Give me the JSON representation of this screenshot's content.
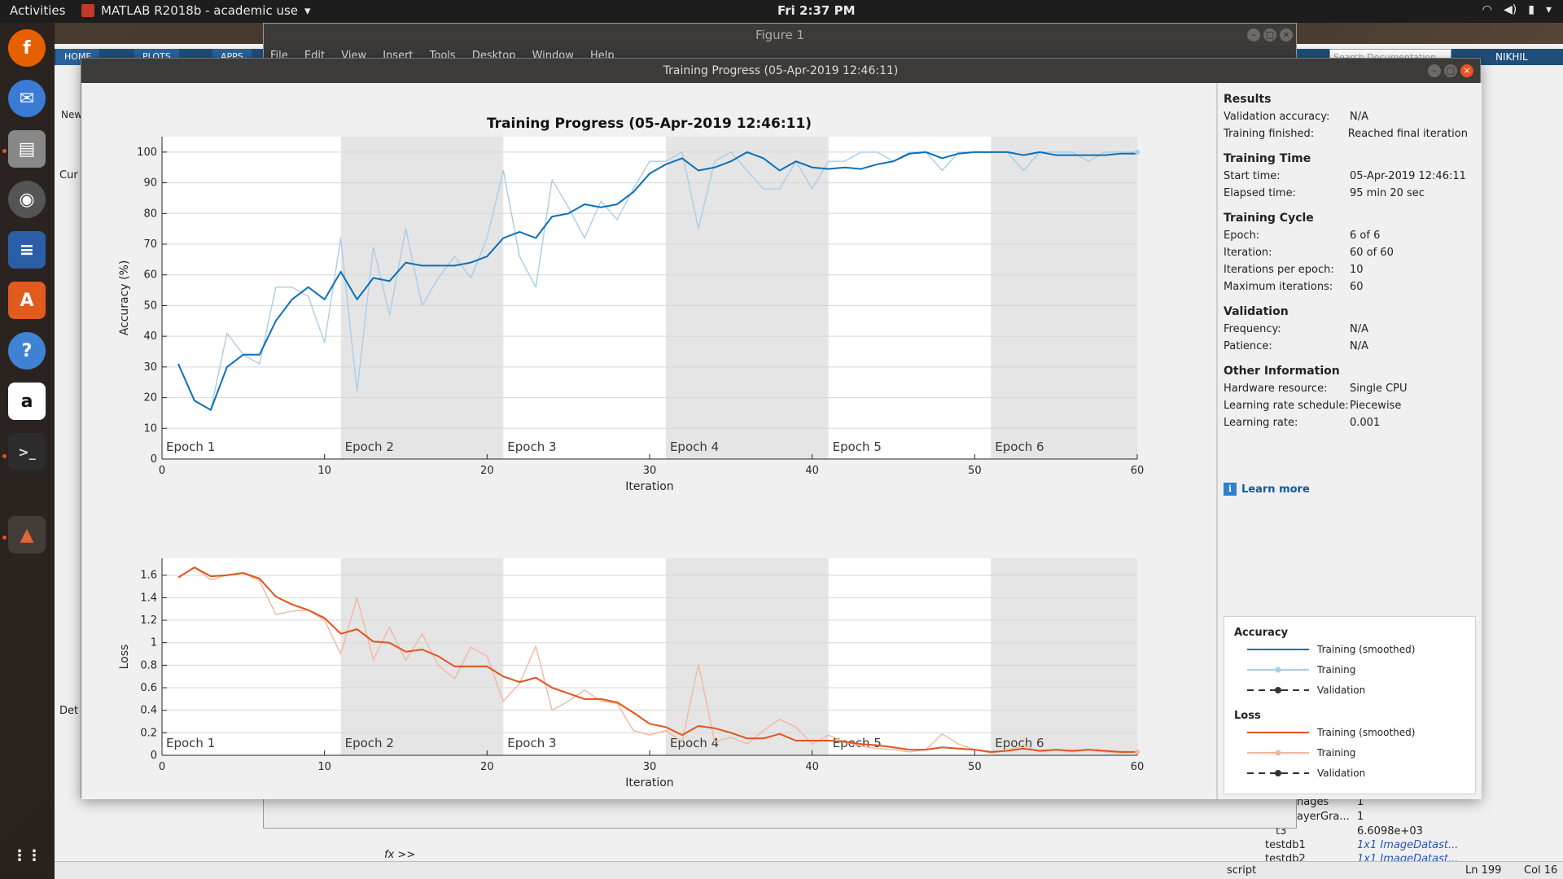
{
  "topbar": {
    "activities": "Activities",
    "app_name": "MATLAB R2018b - academic use",
    "clock": "Fri  2:37 PM"
  },
  "matlab": {
    "tabs": [
      "HOME",
      "PLOTS",
      "APPS"
    ],
    "search_placeholder": "Search Documentation",
    "user": "NIKHIL",
    "current_folder_label": "Cur",
    "details_label": "Det",
    "new_label": "New",
    "command_prompt": ">>",
    "status_script": "script",
    "status_ln": "Ln  199",
    "status_col": "Col  16",
    "workspace_rows": [
      {
        "name": "nages",
        "value": "1"
      },
      {
        "name": "ayerGra...",
        "value": "1"
      },
      {
        "name": "t3",
        "value": "6.6098e+03"
      },
      {
        "name": "testdb1",
        "value": "1x1 ImageDatast..."
      },
      {
        "name": "testdb2",
        "value": "1x1 ImageDatast..."
      }
    ]
  },
  "figure1": {
    "title": "Figure 1",
    "menu": [
      "File",
      "Edit",
      "View",
      "Insert",
      "Tools",
      "Desktop",
      "Window",
      "Help"
    ]
  },
  "training_window": {
    "window_title": "Training Progress (05-Apr-2019 12:46:11)",
    "figure_title": "Training Progress (05-Apr-2019 12:46:11)"
  },
  "info_panel": {
    "results": {
      "title": "Results",
      "rows": [
        {
          "k": "Validation accuracy:",
          "v": "N/A"
        },
        {
          "k": "Training finished:",
          "v": "Reached final iteration"
        }
      ]
    },
    "training_time": {
      "title": "Training Time",
      "rows": [
        {
          "k": "Start time:",
          "v": "05-Apr-2019 12:46:11"
        },
        {
          "k": "Elapsed time:",
          "v": "95 min 20 sec"
        }
      ]
    },
    "training_cycle": {
      "title": "Training Cycle",
      "rows": [
        {
          "k": "Epoch:",
          "v": "6 of 6"
        },
        {
          "k": "Iteration:",
          "v": "60 of 60"
        },
        {
          "k": "Iterations per epoch:",
          "v": "10"
        },
        {
          "k": "Maximum iterations:",
          "v": "60"
        }
      ]
    },
    "validation": {
      "title": "Validation",
      "rows": [
        {
          "k": "Frequency:",
          "v": "N/A"
        },
        {
          "k": "Patience:",
          "v": "N/A"
        }
      ]
    },
    "other": {
      "title": "Other Information",
      "rows": [
        {
          "k": "Hardware resource:",
          "v": "Single CPU"
        },
        {
          "k": "Learning rate schedule:",
          "v": "Piecewise"
        },
        {
          "k": "Learning rate:",
          "v": "0.001"
        }
      ]
    },
    "learn_more": "Learn more"
  },
  "legend": {
    "accuracy_title": "Accuracy",
    "loss_title": "Loss",
    "smoothed": "Training (smoothed)",
    "training": "Training",
    "validation": "Validation",
    "colors": {
      "acc_smooth": "#0b6fb8",
      "acc_raw": "#a9cde8",
      "loss_smooth": "#e0541b",
      "loss_raw": "#f3b79c"
    }
  },
  "chart_data": [
    {
      "type": "line",
      "xlabel": "Iteration",
      "ylabel": "Accuracy (%)",
      "xlim": [
        0,
        60
      ],
      "ylim": [
        0,
        105
      ],
      "xticks": [
        0,
        10,
        20,
        30,
        40,
        50,
        60
      ],
      "yticks": [
        0,
        10,
        20,
        30,
        40,
        50,
        60,
        70,
        80,
        90,
        100
      ],
      "epoch_labels": [
        "Epoch 1",
        "Epoch 2",
        "Epoch 3",
        "Epoch 4",
        "Epoch 5",
        "Epoch 6"
      ],
      "epoch_bounds": [
        0,
        11,
        21,
        31,
        41,
        51,
        60
      ],
      "x": [
        1,
        2,
        3,
        4,
        5,
        6,
        7,
        8,
        9,
        10,
        11,
        12,
        13,
        14,
        15,
        16,
        17,
        18,
        19,
        20,
        21,
        22,
        23,
        24,
        25,
        26,
        27,
        28,
        29,
        30,
        31,
        32,
        33,
        34,
        35,
        36,
        37,
        38,
        39,
        40,
        41,
        42,
        43,
        44,
        45,
        46,
        47,
        48,
        49,
        50,
        51,
        52,
        53,
        54,
        55,
        56,
        57,
        58,
        59,
        60
      ],
      "series": [
        {
          "name": "Training (smoothed)",
          "values": [
            31,
            19,
            16,
            30,
            34,
            34,
            45,
            52,
            56,
            52,
            61,
            52,
            59,
            58,
            64,
            63,
            63,
            63,
            64,
            66,
            72,
            74,
            72,
            79,
            80,
            83,
            82,
            83,
            87,
            93,
            96,
            98,
            94,
            95,
            97,
            100,
            98,
            94,
            97,
            95,
            94.5,
            95,
            94.5,
            96,
            97,
            99.5,
            100,
            98,
            99.5,
            100,
            100,
            100,
            99,
            100,
            99,
            99,
            99,
            99,
            99.5,
            99.5
          ]
        },
        {
          "name": "Training",
          "values": [
            31,
            19,
            16,
            41,
            34,
            31,
            56,
            56,
            53,
            38,
            72,
            22,
            69,
            47,
            75,
            50,
            59,
            66,
            59,
            72,
            94,
            66,
            56,
            91,
            82,
            72,
            84,
            78,
            88,
            97,
            97,
            100,
            75,
            97,
            100,
            94,
            88,
            88,
            97,
            88,
            97,
            97,
            100,
            100,
            97,
            100,
            100,
            94,
            100,
            100,
            100,
            100,
            94,
            100,
            100,
            100,
            97,
            100,
            100,
            100
          ]
        }
      ]
    },
    {
      "type": "line",
      "xlabel": "Iteration",
      "ylabel": "Loss",
      "xlim": [
        0,
        60
      ],
      "ylim": [
        0,
        1.75
      ],
      "xticks": [
        0,
        10,
        20,
        30,
        40,
        50,
        60
      ],
      "yticks": [
        0,
        0.2,
        0.4,
        0.6,
        0.8,
        1,
        1.2,
        1.4,
        1.6
      ],
      "epoch_labels": [
        "Epoch 1",
        "Epoch 2",
        "Epoch 3",
        "Epoch 4",
        "Epoch 5",
        "Epoch 6"
      ],
      "epoch_bounds": [
        0,
        11,
        21,
        31,
        41,
        51,
        60
      ],
      "x": [
        1,
        2,
        3,
        4,
        5,
        6,
        7,
        8,
        9,
        10,
        11,
        12,
        13,
        14,
        15,
        16,
        17,
        18,
        19,
        20,
        21,
        22,
        23,
        24,
        25,
        26,
        27,
        28,
        29,
        30,
        31,
        32,
        33,
        34,
        35,
        36,
        37,
        38,
        39,
        40,
        41,
        42,
        43,
        44,
        45,
        46,
        47,
        48,
        49,
        50,
        51,
        52,
        53,
        54,
        55,
        56,
        57,
        58,
        59,
        60
      ],
      "series": [
        {
          "name": "Training (smoothed)",
          "values": [
            1.58,
            1.67,
            1.59,
            1.6,
            1.62,
            1.57,
            1.41,
            1.34,
            1.29,
            1.22,
            1.08,
            1.12,
            1.01,
            1.0,
            0.92,
            0.94,
            0.88,
            0.79,
            0.79,
            0.79,
            0.7,
            0.65,
            0.69,
            0.6,
            0.55,
            0.5,
            0.5,
            0.47,
            0.38,
            0.28,
            0.25,
            0.18,
            0.26,
            0.24,
            0.2,
            0.15,
            0.15,
            0.19,
            0.13,
            0.13,
            0.13,
            0.12,
            0.1,
            0.09,
            0.07,
            0.05,
            0.05,
            0.07,
            0.06,
            0.05,
            0.03,
            0.04,
            0.06,
            0.04,
            0.05,
            0.04,
            0.05,
            0.04,
            0.03,
            0.03
          ]
        },
        {
          "name": "Training",
          "values": [
            1.58,
            1.67,
            1.56,
            1.6,
            1.62,
            1.55,
            1.25,
            1.28,
            1.29,
            1.2,
            0.9,
            1.4,
            0.85,
            1.14,
            0.84,
            1.08,
            0.8,
            0.68,
            0.96,
            0.88,
            0.48,
            0.64,
            0.97,
            0.4,
            0.48,
            0.58,
            0.48,
            0.46,
            0.22,
            0.18,
            0.22,
            0.12,
            0.81,
            0.12,
            0.16,
            0.1,
            0.22,
            0.32,
            0.25,
            0.1,
            0.18,
            0.12,
            0.08,
            0.06,
            0.05,
            0.03,
            0.05,
            0.19,
            0.1,
            0.05,
            0.02,
            0.04,
            0.09,
            0.03,
            0.05,
            0.03,
            0.05,
            0.03,
            0.02,
            0.03
          ]
        }
      ]
    }
  ]
}
